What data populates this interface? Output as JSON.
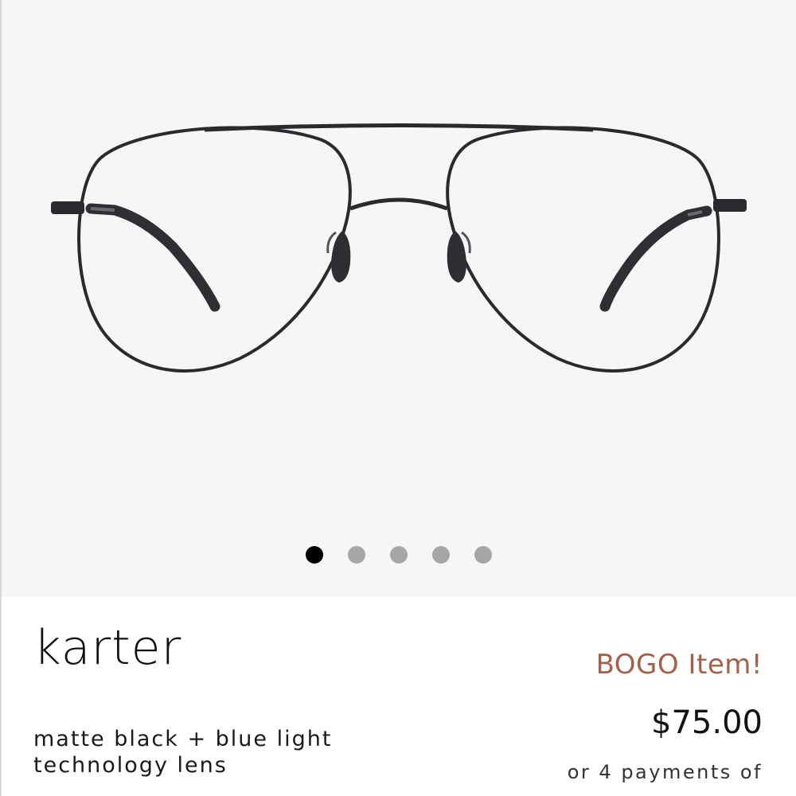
{
  "gallery": {
    "image": "aviator-glasses-front-view",
    "dots": [
      {
        "active": true
      },
      {
        "active": false
      },
      {
        "active": false
      },
      {
        "active": false
      },
      {
        "active": false
      }
    ],
    "active_index": 0,
    "total_images": 5
  },
  "product": {
    "name": "karter",
    "description_line1": "matte black + blue light",
    "description_line2": "technology lens",
    "badge": "BOGO Item!",
    "price": "$75.00",
    "payments": "or 4 payments of"
  },
  "colors": {
    "badge": "#a5604a",
    "gallery_bg": "#f6f6f6",
    "dot_active": "#000000",
    "dot_inactive": "#a6a6a6"
  }
}
